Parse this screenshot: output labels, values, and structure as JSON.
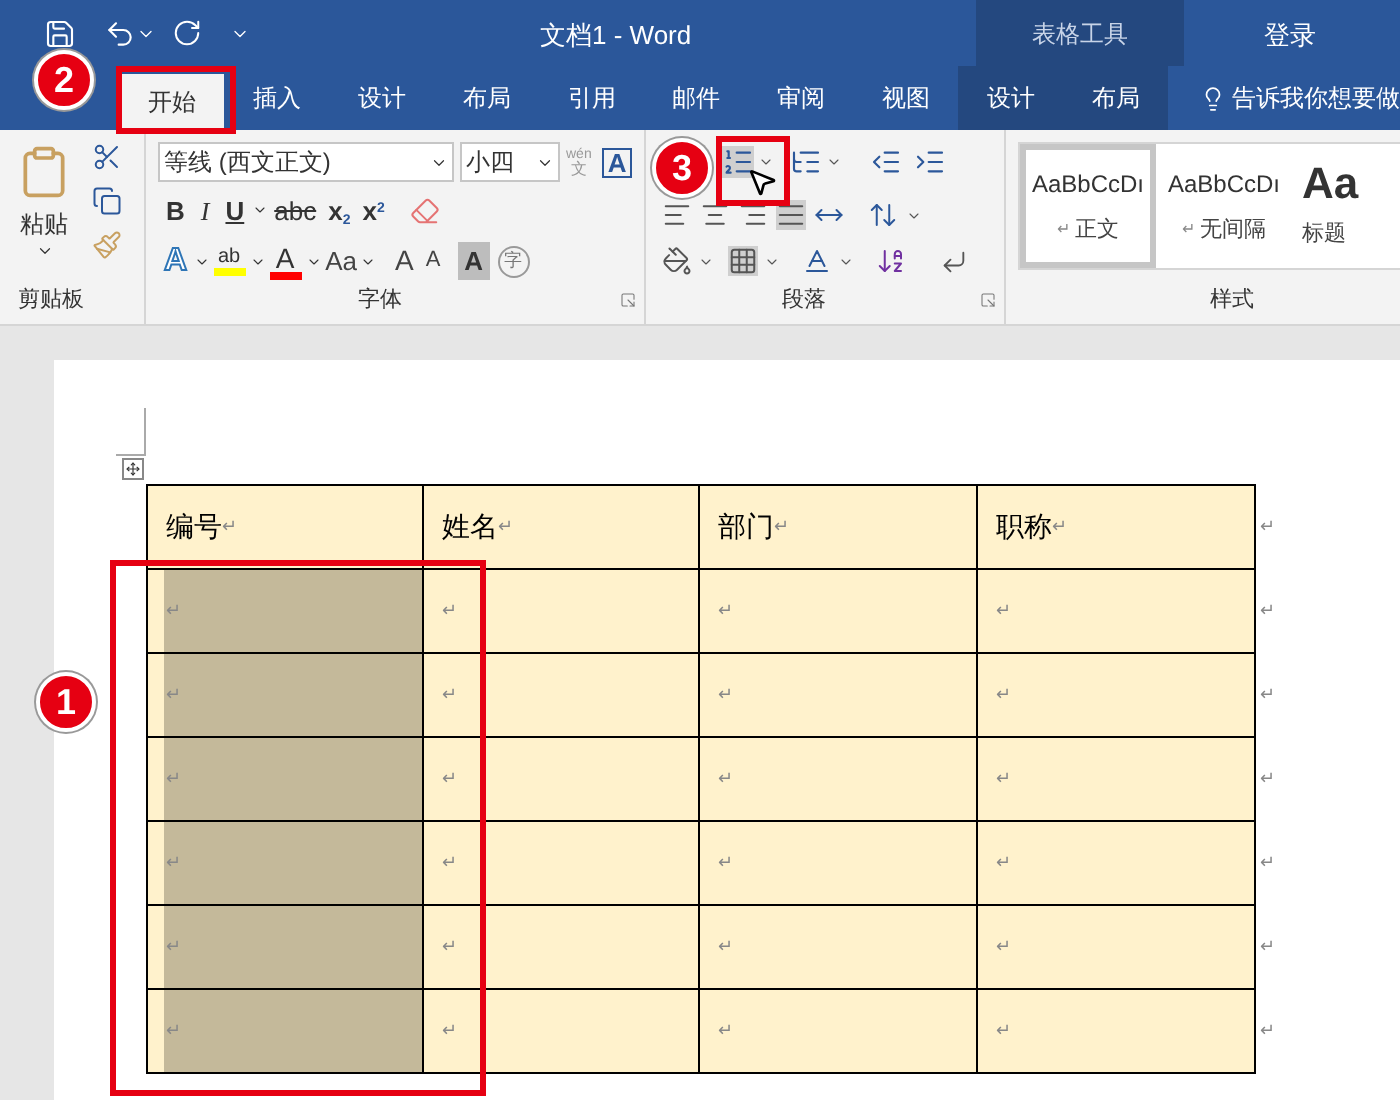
{
  "window": {
    "title": "文档1  -  Word",
    "context_title": "表格工具",
    "login": "登录"
  },
  "tabs": [
    {
      "label": "开始",
      "selected": true,
      "context": false
    },
    {
      "label": "插入",
      "selected": false,
      "context": false
    },
    {
      "label": "设计",
      "selected": false,
      "context": false
    },
    {
      "label": "布局",
      "selected": false,
      "context": false
    },
    {
      "label": "引用",
      "selected": false,
      "context": false
    },
    {
      "label": "邮件",
      "selected": false,
      "context": false
    },
    {
      "label": "审阅",
      "selected": false,
      "context": false
    },
    {
      "label": "视图",
      "selected": false,
      "context": false
    },
    {
      "label": "设计",
      "selected": false,
      "context": true
    },
    {
      "label": "布局",
      "selected": false,
      "context": true
    }
  ],
  "tell_me": "告诉我你想要做",
  "ribbon": {
    "clipboard": {
      "paste": "粘贴",
      "label": "剪贴板"
    },
    "font": {
      "name": "等线 (西文正文)",
      "size": "小四",
      "phonetic_top": "wén",
      "phonetic_bottom": "文",
      "border_char": "A",
      "label": "字体",
      "row2": [
        {
          "kind": "bold",
          "label": "B"
        },
        {
          "kind": "italic",
          "label": "I"
        },
        {
          "kind": "underline",
          "label": "U"
        },
        {
          "kind": "strike",
          "label": "abc"
        },
        {
          "kind": "sub",
          "label": "x",
          "script": "2"
        },
        {
          "kind": "sup",
          "label": "x",
          "script": "2"
        }
      ],
      "row3": [
        {
          "kind": "effect",
          "label": "A"
        },
        {
          "kind": "highlight",
          "label": "ab",
          "color": "#ffff00"
        },
        {
          "kind": "fontcolor",
          "label": "A",
          "color": "#ff0000"
        },
        {
          "kind": "case",
          "label": "Aa"
        },
        {
          "kind": "grow",
          "label": "A"
        },
        {
          "kind": "shrink",
          "label": "A"
        },
        {
          "kind": "shade",
          "label": "A"
        },
        {
          "kind": "enclose",
          "label": "字"
        }
      ]
    },
    "paragraph": {
      "label": "段落"
    },
    "styles": {
      "label": "样式",
      "items": [
        {
          "preview": "AaBbCcDı",
          "name": "正文",
          "mark": "↵",
          "selected": true,
          "kind": "normal"
        },
        {
          "preview": "AaBbCcDı",
          "name": "无间隔",
          "mark": "↵",
          "selected": false,
          "kind": "normal"
        },
        {
          "preview": "Aa",
          "name": "标题",
          "selected": false,
          "kind": "heading"
        }
      ]
    }
  },
  "table": {
    "header": [
      {
        "text": "编号",
        "mark": "↵"
      },
      {
        "text": "姓名",
        "mark": "↵"
      },
      {
        "text": "部门",
        "mark": "↵"
      },
      {
        "text": "职称",
        "mark": "↵"
      }
    ],
    "header_end": "↵",
    "rows": [
      {
        "cells": [
          {
            "mark": "↵",
            "selected": true
          },
          {
            "mark": "↵",
            "selected": false
          },
          {
            "mark": "↵",
            "selected": false
          },
          {
            "mark": "↵",
            "selected": false
          }
        ],
        "end": "↵"
      },
      {
        "cells": [
          {
            "mark": "↵",
            "selected": true
          },
          {
            "mark": "↵",
            "selected": false
          },
          {
            "mark": "↵",
            "selected": false
          },
          {
            "mark": "↵",
            "selected": false
          }
        ],
        "end": "↵"
      },
      {
        "cells": [
          {
            "mark": "↵",
            "selected": true
          },
          {
            "mark": "↵",
            "selected": false
          },
          {
            "mark": "↵",
            "selected": false
          },
          {
            "mark": "↵",
            "selected": false
          }
        ],
        "end": "↵"
      },
      {
        "cells": [
          {
            "mark": "↵",
            "selected": true
          },
          {
            "mark": "↵",
            "selected": false
          },
          {
            "mark": "↵",
            "selected": false
          },
          {
            "mark": "↵",
            "selected": false
          }
        ],
        "end": "↵"
      },
      {
        "cells": [
          {
            "mark": "↵",
            "selected": true
          },
          {
            "mark": "↵",
            "selected": false
          },
          {
            "mark": "↵",
            "selected": false
          },
          {
            "mark": "↵",
            "selected": false
          }
        ],
        "end": "↵"
      },
      {
        "cells": [
          {
            "mark": "↵",
            "selected": true
          },
          {
            "mark": "↵",
            "selected": false
          },
          {
            "mark": "↵",
            "selected": false
          },
          {
            "mark": "↵",
            "selected": false
          }
        ],
        "end": "↵"
      }
    ]
  },
  "annotations": [
    {
      "number": "1",
      "kind": "column"
    },
    {
      "number": "2",
      "kind": "tab"
    },
    {
      "number": "3",
      "kind": "button"
    }
  ]
}
